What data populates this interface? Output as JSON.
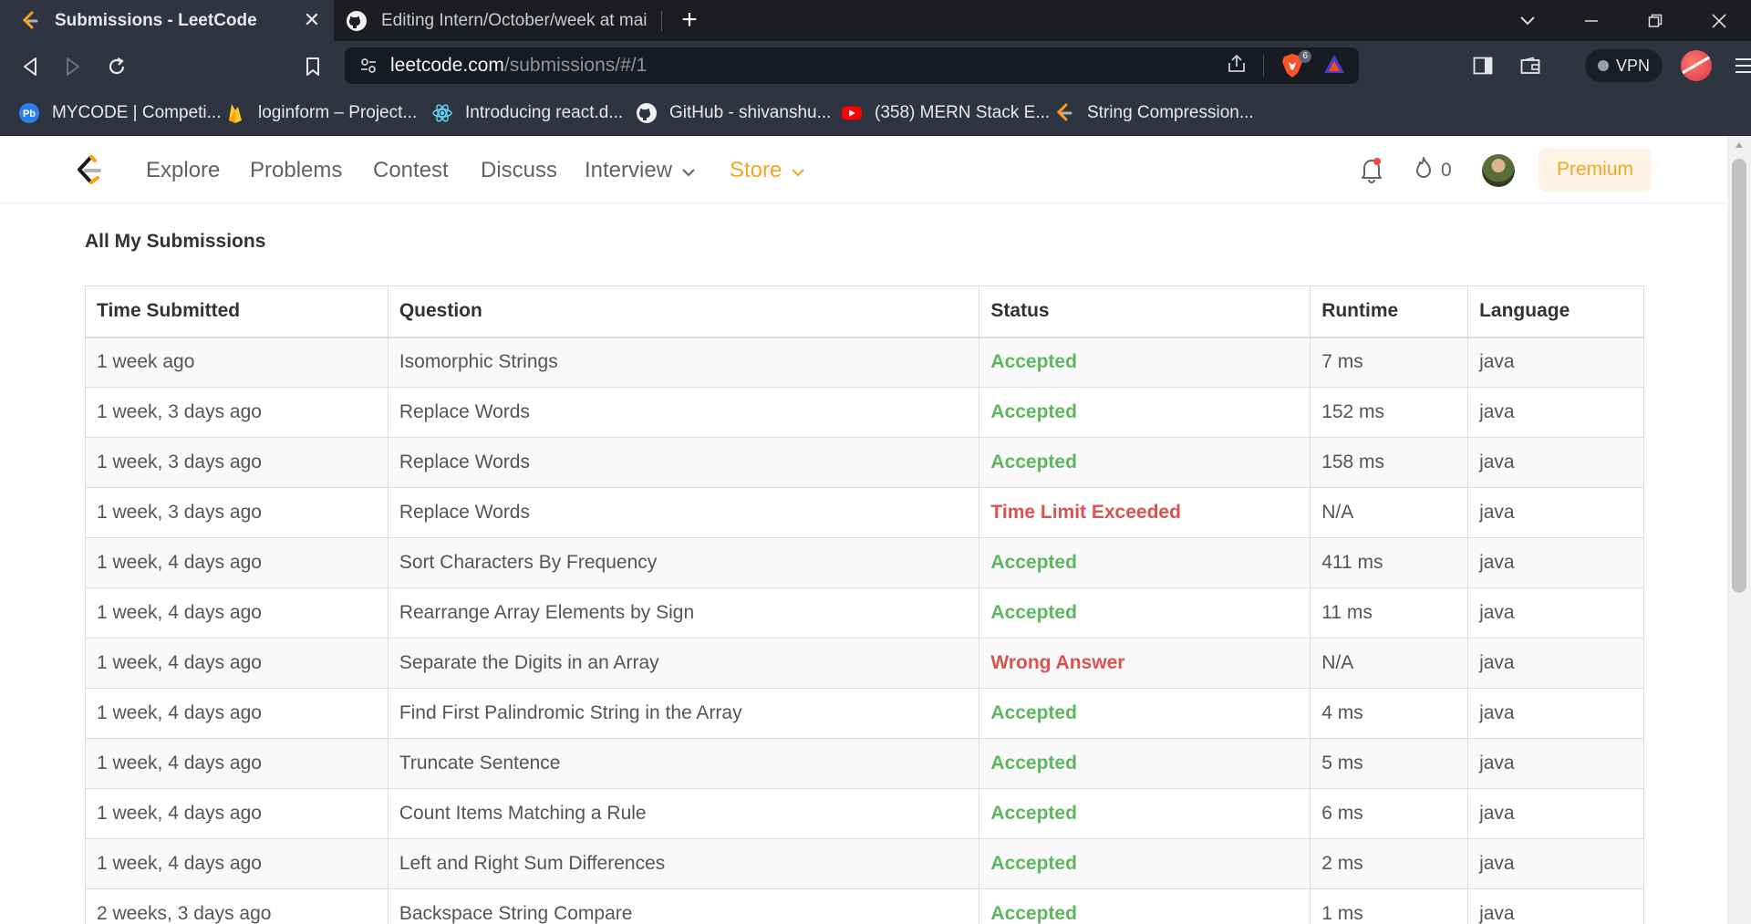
{
  "browser": {
    "tabs": [
      {
        "title": "Submissions - LeetCode",
        "favicon": "leetcode-icon",
        "active": true
      },
      {
        "title": "Editing Intern/October/week at main ·",
        "favicon": "github-icon",
        "active": false
      }
    ],
    "url": {
      "host": "leetcode.com",
      "path": "/submissions/#/1"
    },
    "brave_shield_count": "6",
    "vpn_label": "VPN",
    "bookmarks": [
      {
        "label": "MYCODE | Competi...",
        "icon": "pb-icon"
      },
      {
        "label": "loginform – Project...",
        "icon": "firebase-icon"
      },
      {
        "label": "Introducing react.d...",
        "icon": "react-icon"
      },
      {
        "label": "GitHub - shivanshu...",
        "icon": "github-icon"
      },
      {
        "label": "(358) MERN Stack E...",
        "icon": "youtube-icon"
      },
      {
        "label": "String Compression...",
        "icon": "leetcode-icon"
      }
    ]
  },
  "site_nav": {
    "items": [
      "Explore",
      "Problems",
      "Contest",
      "Discuss",
      "Interview",
      "Store"
    ],
    "streak_count": "0",
    "premium_label": "Premium",
    "accent_color": "#f5a623"
  },
  "page": {
    "heading": "All My Submissions",
    "columns": [
      "Time Submitted",
      "Question",
      "Status",
      "Runtime",
      "Language"
    ],
    "rows": [
      {
        "time": "1 week ago",
        "question": "Isomorphic Strings",
        "status": "Accepted",
        "runtime": "7 ms",
        "language": "java"
      },
      {
        "time": "1 week, 3 days ago",
        "question": "Replace Words",
        "status": "Accepted",
        "runtime": "152 ms",
        "language": "java"
      },
      {
        "time": "1 week, 3 days ago",
        "question": "Replace Words",
        "status": "Accepted",
        "runtime": "158 ms",
        "language": "java"
      },
      {
        "time": "1 week, 3 days ago",
        "question": "Replace Words",
        "status": "Time Limit Exceeded",
        "runtime": "N/A",
        "language": "java"
      },
      {
        "time": "1 week, 4 days ago",
        "question": "Sort Characters By Frequency",
        "status": "Accepted",
        "runtime": "411 ms",
        "language": "java"
      },
      {
        "time": "1 week, 4 days ago",
        "question": "Rearrange Array Elements by Sign",
        "status": "Accepted",
        "runtime": "11 ms",
        "language": "java"
      },
      {
        "time": "1 week, 4 days ago",
        "question": "Separate the Digits in an Array",
        "status": "Wrong Answer",
        "runtime": "N/A",
        "language": "java"
      },
      {
        "time": "1 week, 4 days ago",
        "question": "Find First Palindromic String in the Array",
        "status": "Accepted",
        "runtime": "4 ms",
        "language": "java"
      },
      {
        "time": "1 week, 4 days ago",
        "question": "Truncate Sentence",
        "status": "Accepted",
        "runtime": "5 ms",
        "language": "java"
      },
      {
        "time": "1 week, 4 days ago",
        "question": "Count Items Matching a Rule",
        "status": "Accepted",
        "runtime": "6 ms",
        "language": "java"
      },
      {
        "time": "1 week, 4 days ago",
        "question": "Left and Right Sum Differences",
        "status": "Accepted",
        "runtime": "2 ms",
        "language": "java"
      },
      {
        "time": "2 weeks, 3 days ago",
        "question": "Backspace String Compare",
        "status": "Accepted",
        "runtime": "1 ms",
        "language": "java"
      }
    ],
    "status_colors": {
      "accepted": "#5cb85c",
      "rejected": "#d9534f"
    }
  }
}
